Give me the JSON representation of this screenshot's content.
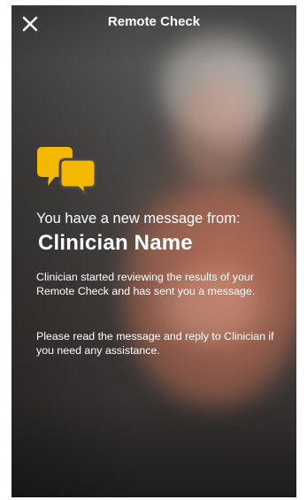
{
  "header": {
    "title": "Remote Check",
    "close_icon": "close-icon"
  },
  "message": {
    "icon": "chat-bubbles-icon",
    "icon_color": "#F5B800",
    "heading": "You have a new message from:",
    "sender_name": "Clinician Name",
    "paragraph_1": "Clinician started reviewing the results of your Remote Check and has sent you a message.",
    "paragraph_2": "Please read the message and reply to Clinician if you need any assistance."
  },
  "colors": {
    "text": "#FFFFFF",
    "accent": "#F5B800"
  }
}
